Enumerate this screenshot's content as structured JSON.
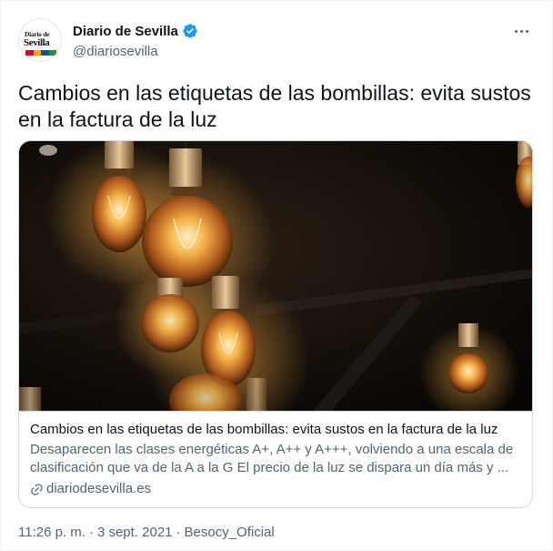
{
  "account": {
    "avatar_line1": "Diario de",
    "avatar_line2": "Sevilla",
    "display_name": "Diario de Sevilla",
    "handle": "@diariosevilla"
  },
  "tweet": {
    "text": "Cambios en las etiquetas de las bombillas: evita sustos en la factura de la luz"
  },
  "card": {
    "title": "Cambios en las etiquetas de las bombillas: evita sustos en la factura de la luz",
    "description": "Desaparecen las clases energéticas A+, A++ y A+++, volviendo a una escala de clasificación que va de la A a la G El precio de la luz se dispara un día más y ...",
    "domain": "diariodesevilla.es"
  },
  "footer": {
    "time": "11:26 p. m.",
    "separator1": "·",
    "date": "3 sept. 2021",
    "separator2": "·",
    "source": "Besocy_Oficial"
  },
  "colors": {
    "verified": "#1d9bf0",
    "text_primary": "#0f1419",
    "text_secondary": "#536471",
    "border": "#cfd9de",
    "avatar_stripes": [
      "#c8102e",
      "#f2a900",
      "#1f4e9b",
      "#2a8c3a"
    ]
  },
  "icons": {
    "verified": "verified-badge-icon",
    "more": "more-dots-icon",
    "link": "link-icon"
  }
}
